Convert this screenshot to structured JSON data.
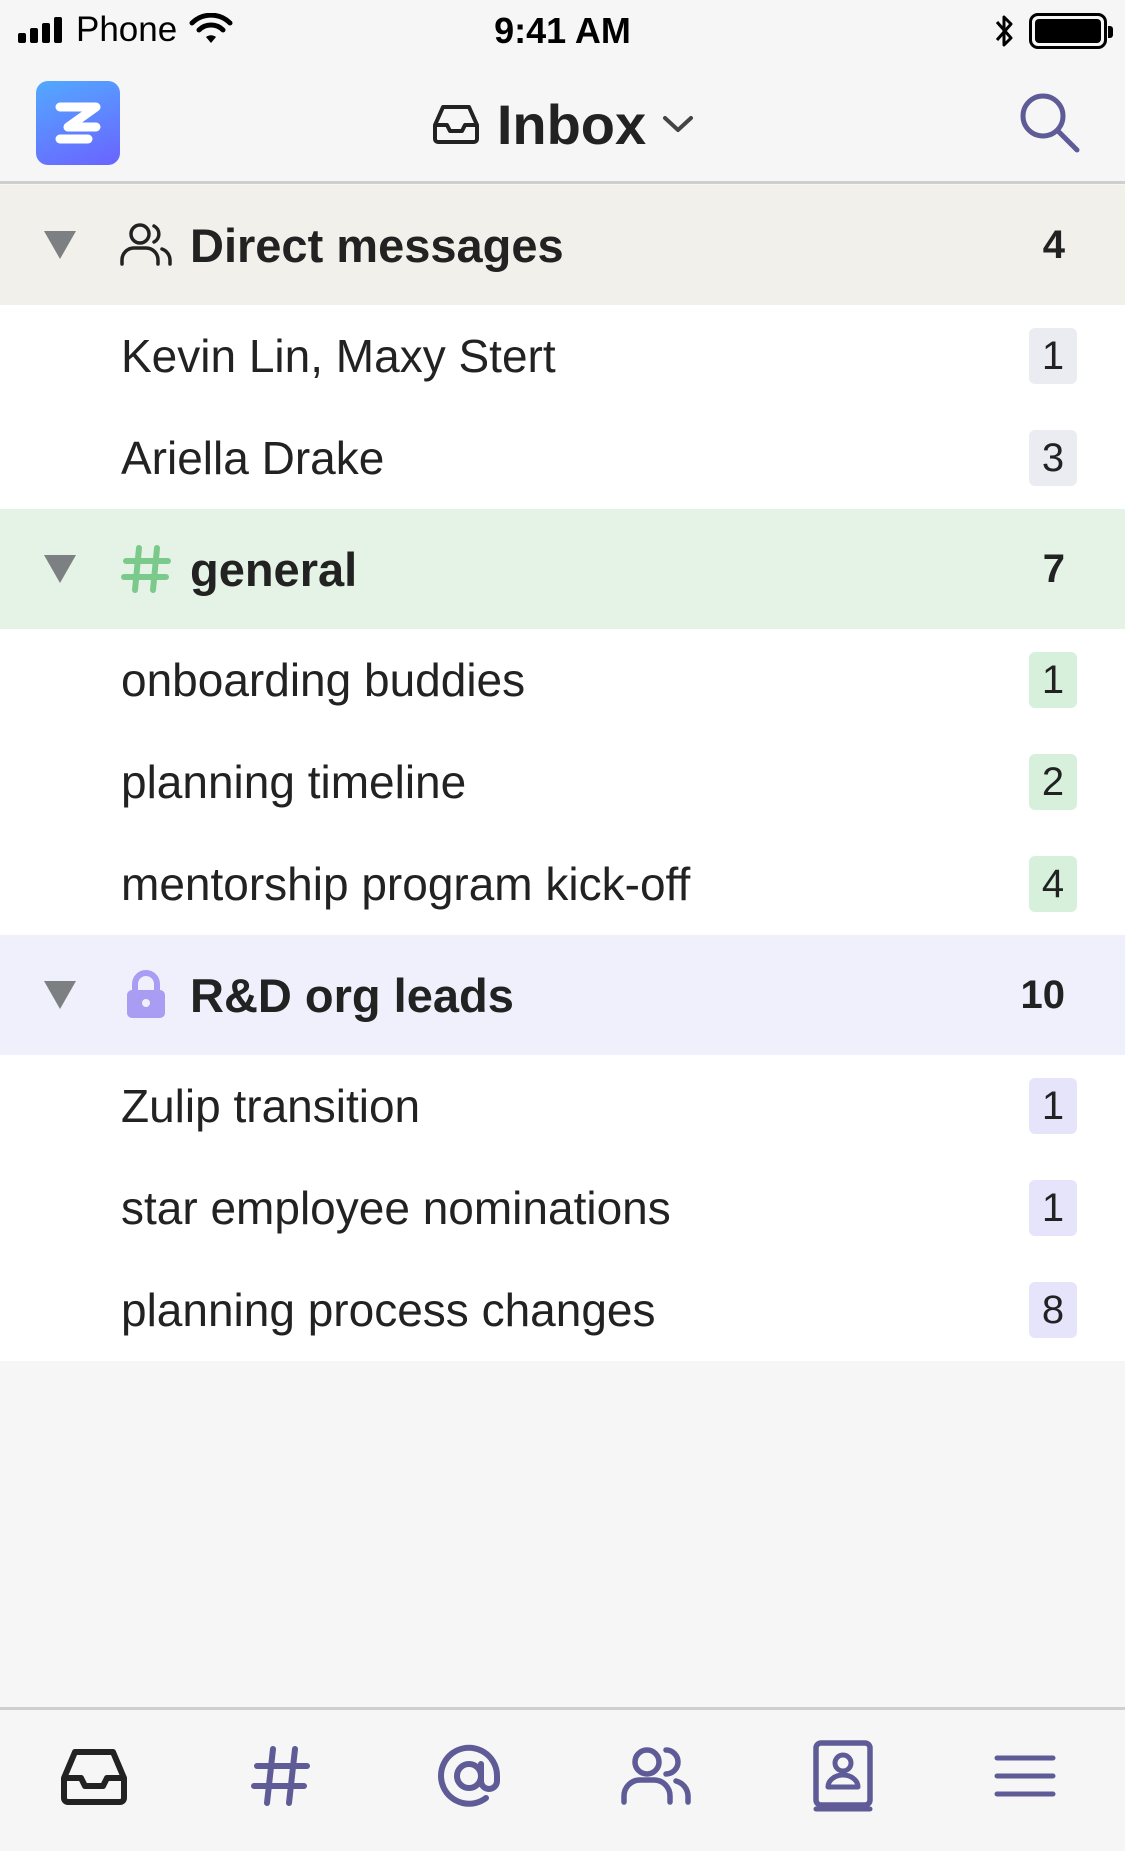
{
  "status_bar": {
    "carrier": "Phone",
    "time": "9:41 AM"
  },
  "header": {
    "title": "Inbox",
    "logo_letter": "Z"
  },
  "colors": {
    "dm_header_bg": "#f2f0ea",
    "general_header_bg": "#e5f3e6",
    "general_badge_bg": "#d7f0dc",
    "general_hash": "#7cc98c",
    "rd_header_bg": "#eff0fb",
    "rd_badge_bg": "#e6e4fb",
    "rd_lock": "#a99cf3",
    "dm_badge_bg": "#ebebf2",
    "nav_icon": "#5f5b97",
    "nav_active": "#222222"
  },
  "inbox": {
    "direct_messages": {
      "label": "Direct messages",
      "count": "4",
      "items": [
        {
          "label": "Kevin Lin, Maxy Stert",
          "count": "1"
        },
        {
          "label": "Ariella Drake",
          "count": "3"
        }
      ]
    },
    "general": {
      "label": "general",
      "count": "7",
      "items": [
        {
          "label": "onboarding buddies",
          "count": "1"
        },
        {
          "label": "planning timeline",
          "count": "2"
        },
        {
          "label": "mentorship program kick-off",
          "count": "4"
        }
      ]
    },
    "rd_org_leads": {
      "label": "R&D org leads",
      "count": "10",
      "items": [
        {
          "label": "Zulip transition",
          "count": "1"
        },
        {
          "label": "star employee nominations",
          "count": "1"
        },
        {
          "label": "planning process changes",
          "count": "8"
        }
      ]
    }
  },
  "bottom_nav": {
    "items": [
      "inbox-icon",
      "channels-icon",
      "mentions-icon",
      "direct-messages-icon",
      "profile-icon",
      "menu-icon"
    ],
    "active": "inbox-icon"
  }
}
